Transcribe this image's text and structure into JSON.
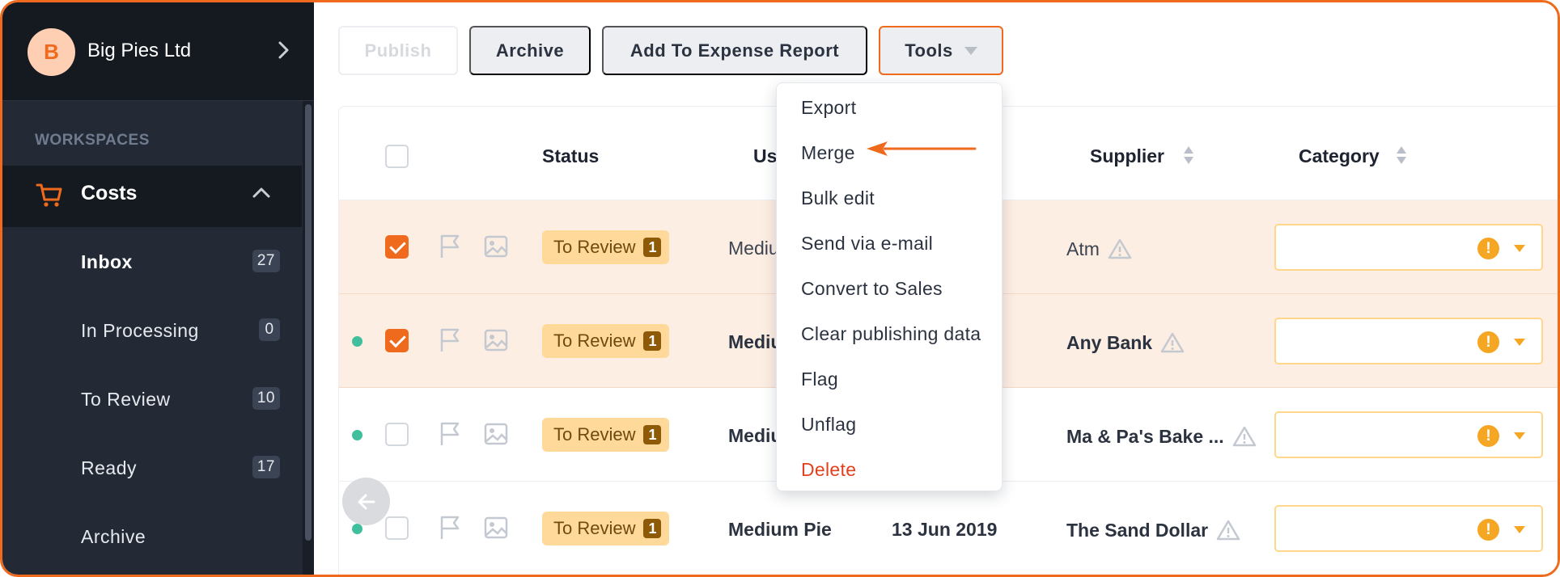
{
  "company": {
    "initial": "B",
    "name": "Big Pies Ltd"
  },
  "sidebar": {
    "workspaces_title": "WORKSPACES",
    "section": "Costs",
    "items": [
      {
        "label": "Inbox",
        "count": "27",
        "active": true
      },
      {
        "label": "In Processing",
        "count": "0"
      },
      {
        "label": "To Review",
        "count": "10"
      },
      {
        "label": "Ready",
        "count": "17"
      },
      {
        "label": "Archive",
        "count": ""
      }
    ]
  },
  "toolbar": {
    "publish": "Publish",
    "archive": "Archive",
    "add_expense": "Add To Expense Report",
    "tools": "Tools"
  },
  "table": {
    "headers": {
      "status": "Status",
      "user": "Us",
      "supplier": "Supplier",
      "category": "Category"
    },
    "rows": [
      {
        "selected": true,
        "dot": false,
        "status": "To Review",
        "count": "1",
        "user": "Mediu",
        "date": "",
        "supplier": "Atm",
        "supplier_bold": false
      },
      {
        "selected": true,
        "dot": true,
        "status": "To Review",
        "count": "1",
        "user": "Mediu",
        "date": "",
        "supplier": "Any Bank",
        "supplier_bold": true
      },
      {
        "selected": false,
        "dot": true,
        "status": "To Review",
        "count": "1",
        "user": "Mediu",
        "date": "",
        "supplier": "Ma & Pa's Bake ...",
        "supplier_bold": true
      },
      {
        "selected": false,
        "dot": true,
        "status": "To Review",
        "count": "1",
        "user": "Medium Pie",
        "date": "13 Jun 2019",
        "supplier": "The Sand Dollar",
        "supplier_bold": true
      }
    ]
  },
  "tools_menu": {
    "items": [
      "Export",
      "Merge",
      "Bulk edit",
      "Send via e-mail",
      "Convert to Sales",
      "Clear publishing data",
      "Flag",
      "Unflag"
    ],
    "danger_item": "Delete"
  },
  "colors": {
    "accent": "#f06a1d",
    "sidebar": "#232a35",
    "status_pill": "#ffd99a",
    "online_dot": "#3fbf9c",
    "warning": "#f5a623"
  }
}
